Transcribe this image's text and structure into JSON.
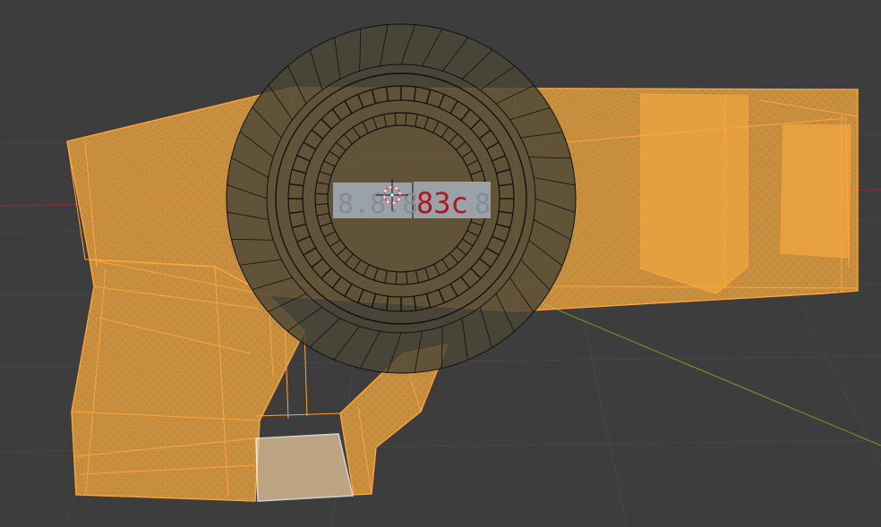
{
  "viewport": {
    "background": "#3d3d3d",
    "grid_color": "#474747",
    "x_axis_color": "#8a2a35",
    "y_axis_color": "#6c8f2a"
  },
  "selection": {
    "edge_color": "#ffa53a",
    "fill_color": "#f0a640",
    "active_face_edge_color": "#ffffff"
  },
  "bezel": {
    "wire_color": "#111111",
    "fill_color": "#4b4637"
  },
  "display": {
    "screen_color": "#9aa2a8",
    "digit_color": "#b0141e",
    "unlit_digits": "8.8.8",
    "lit_digits": "83c",
    "ghost_trailing": "8"
  },
  "cursor": {
    "name": "3d-cursor"
  }
}
